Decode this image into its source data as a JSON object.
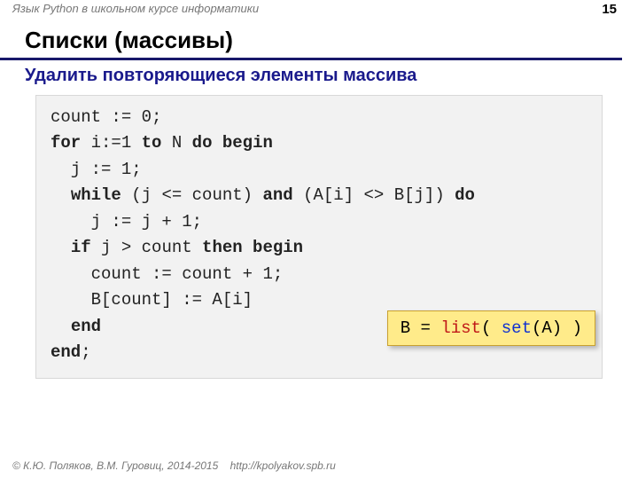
{
  "header": {
    "course_label": "Язык Python в школьном курсе информатики",
    "page_number": "15",
    "title": "Списки (массивы)",
    "subtitle": "Удалить повторяющиеся элементы массива"
  },
  "code": {
    "l1_a": "count := 0;",
    "l2_kw1": "for",
    "l2_a": " i:=1 ",
    "l2_kw2": "to",
    "l2_b": " N ",
    "l2_kw3": "do begin",
    "l3_a": "  j := 1;",
    "l4_a": "  ",
    "l4_kw1": "while",
    "l4_b": " (j ",
    "l4_c": "<=",
    "l4_d": " count) ",
    "l4_kw2": "and",
    "l4_e": " (A[i] ",
    "l4_f": "<>",
    "l4_g": " B[j]) ",
    "l4_kw3": "do",
    "l5_a": "    j := j + 1;",
    "l6_a": "  ",
    "l6_kw1": "if",
    "l6_b": " j > count ",
    "l6_kw2": "then begin",
    "l7_a": "    count := count + 1;",
    "l8_a": "    B[count] := A[i]",
    "l9_a": "  ",
    "l9_kw1": "end",
    "l10_kw1": "end",
    "l10_a": ";"
  },
  "python": {
    "a": "B = ",
    "list": "list",
    "b": "( ",
    "set": "set",
    "c": "(A) )"
  },
  "footer": {
    "copyright": "© К.Ю. Поляков, В.М. Гуровиц, 2014-2015",
    "url": "http://kpolyakov.spb.ru"
  }
}
